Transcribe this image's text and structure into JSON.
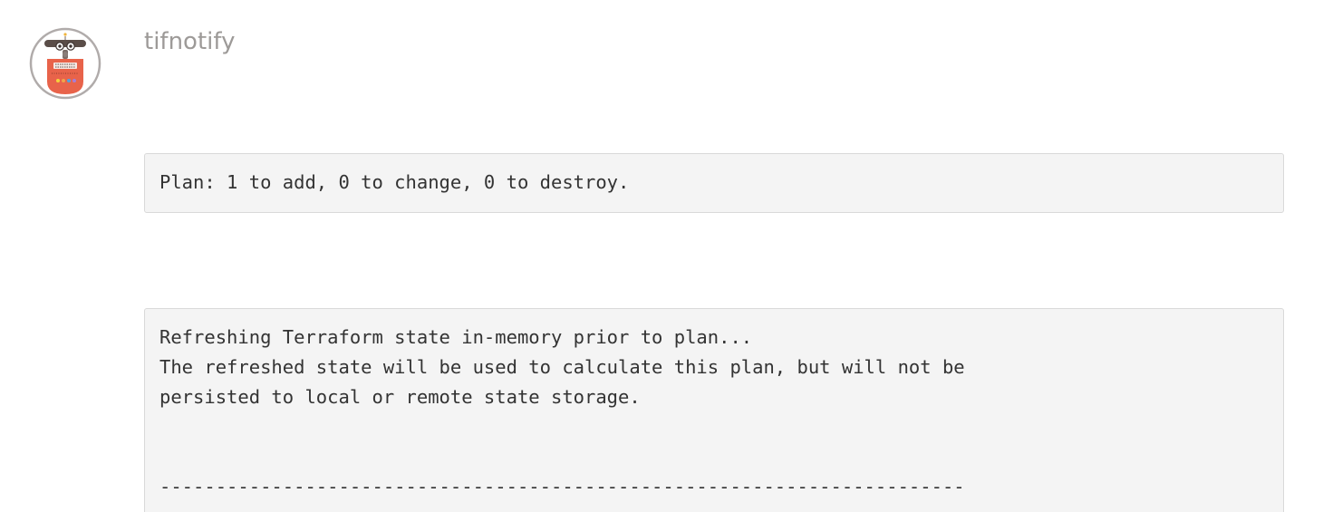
{
  "message": {
    "author": "tifnotify",
    "avatar_icon": "robot-icon",
    "plan_block": {
      "lines": [
        "Plan: 1 to add, 0 to change, 0 to destroy."
      ]
    },
    "refresh_block": {
      "lines": [
        "Refreshing Terraform state in-memory prior to plan...",
        "The refreshed state will be used to calculate this plan, but will not be",
        "persisted to local or remote state storage.",
        "",
        "",
        "------------------------------------------------------------------------"
      ]
    }
  },
  "colors": {
    "author_text": "#9d9a98",
    "code_background": "#f4f4f4",
    "code_border": "#d9d9d9",
    "robot_body": "#e8634a",
    "robot_head": "#5a4d48"
  }
}
